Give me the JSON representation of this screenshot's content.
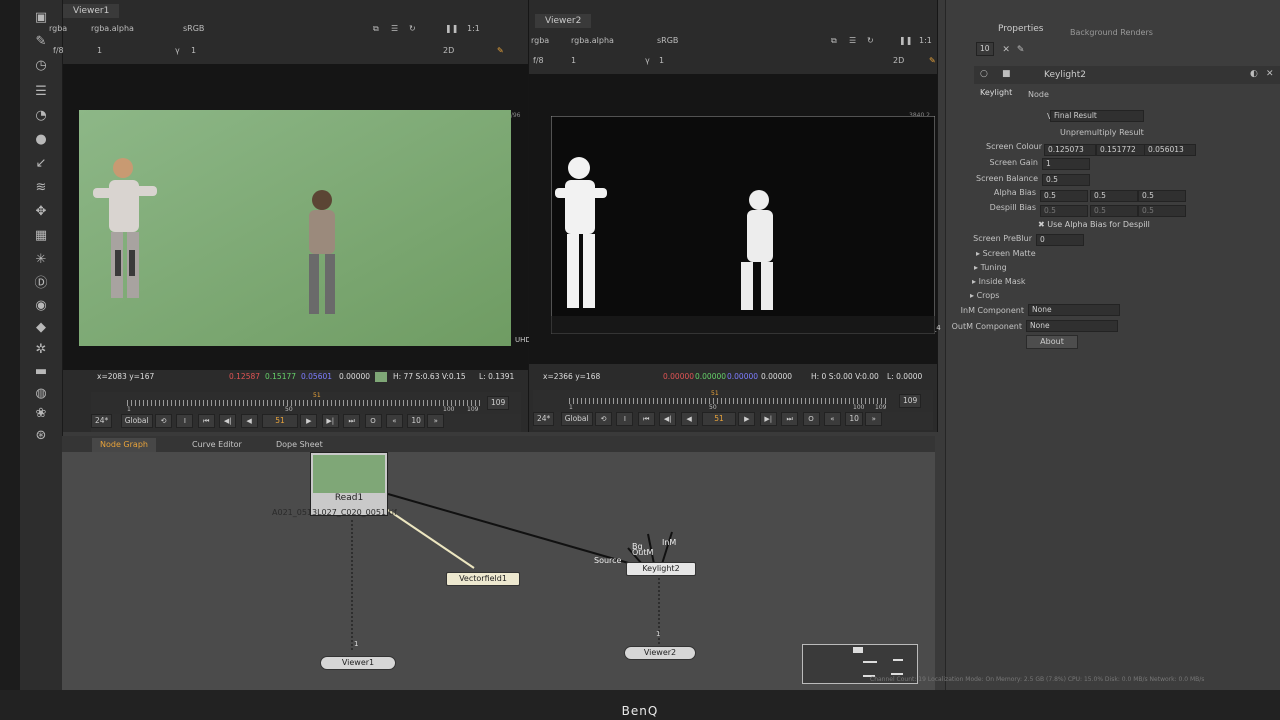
{
  "viewer1": {
    "tab": "Viewer1",
    "channels": "rgba",
    "alpha": "rgba.alpha",
    "colorspace": "sRGB",
    "zoom": "1:1",
    "fstop": "f/8",
    "gain": "1",
    "gamma_label": "γ",
    "gamma": "1",
    "mode2d": "2D",
    "coords": "x=2083 y=167",
    "r": "0.12587",
    "g": "0.15177",
    "b": "0.05601",
    "a": "0.00000",
    "hsv": "H: 77 S:0.63 V:0.15",
    "lum": "L: 0.1391",
    "fmt_top": "1/96",
    "fmt_side": "UHD",
    "frame_start": "1",
    "frame_mid": "50",
    "frame_end_a": "100",
    "frame_end_b": "109",
    "frame_max": "109",
    "current_frame": "51",
    "fps": "24*",
    "scope": "Global",
    "step": "10"
  },
  "viewer2": {
    "tab": "Viewer2",
    "channels": "rgba",
    "alpha": "rgba.alpha",
    "colorspace": "sRGB",
    "zoom": "1:1",
    "fstop": "f/8",
    "gain": "1",
    "gamma_label": "γ",
    "gamma": "1",
    "mode2d": "2D",
    "coords": "x=2366 y=168",
    "r": "0.00000",
    "g": "0.00000",
    "b": "0.00000",
    "a": "0.00000",
    "hsv": "H:  0 S:0.00 V:0.00",
    "lum": "L: 0.0000",
    "fmt_top": "3840,2",
    "fmt_side": "UHD_4",
    "frame_start": "1",
    "frame_mid": "50",
    "frame_end_a": "100",
    "frame_end_b": "109",
    "frame_max": "109",
    "current_frame": "51",
    "fps": "24*",
    "scope": "Global",
    "step": "10"
  },
  "graph": {
    "tabs": [
      "Node Graph",
      "Curve Editor",
      "Dope Sheet"
    ],
    "nodes": {
      "read": "Read1",
      "read_file": "A021_0513L027_C020_0051.tif",
      "vectorfield": "Vectorfield1",
      "keylight": "Keylight2",
      "viewer1": "Viewer1",
      "viewer2": "Viewer2"
    },
    "inputs": {
      "source": "Source",
      "bg": "Bg",
      "outm": "OutM",
      "inm": "InM",
      "pipe1": "1",
      "pipe2": "1"
    }
  },
  "properties": {
    "tabs": [
      "Properties",
      "Background Renders"
    ],
    "max_panels": "10",
    "node_name": "Keylight2",
    "subtabs": [
      "Keylight",
      "Node"
    ],
    "view_label": "View",
    "view_value": "Final Result",
    "unpremultiply": "Unpremultiply Result",
    "screen_colour_label": "Screen Colour",
    "screen_colour": [
      "0.125073",
      "0.151772",
      "0.056013"
    ],
    "screen_gain_label": "Screen Gain",
    "screen_gain": "1",
    "screen_balance_label": "Screen Balance",
    "screen_balance": "0.5",
    "alpha_bias_label": "Alpha Bias",
    "alpha_bias": [
      "0.5",
      "0.5",
      "0.5"
    ],
    "despill_bias_label": "Despill Bias",
    "despill_bias": [
      "0.5",
      "0.5",
      "0.5"
    ],
    "use_alpha_bias": "Use Alpha Bias for Despill",
    "preblur_label": "Screen PreBlur",
    "preblur": "0",
    "groups": [
      "Screen Matte",
      "Tuning",
      "Inside Mask",
      "Crops"
    ],
    "inm_label": "InM Component",
    "inm_value": "None",
    "outm_label": "OutM Component",
    "outm_value": "None",
    "about": "About"
  },
  "status": "Channel Count: 19  Localization Mode: On  Memory: 2.5 GB (7.8%)  CPU: 15.0%  Disk: 0.0 MB/s  Network: 0.0 MB/s",
  "brand": "BenQ",
  "colors": {
    "accent": "#e8a33a",
    "greenscreen": "#7fa777",
    "node_read": "#c9c9c9",
    "node_keylight": "#e6e6e6",
    "node_vector": "#ede8cf"
  }
}
